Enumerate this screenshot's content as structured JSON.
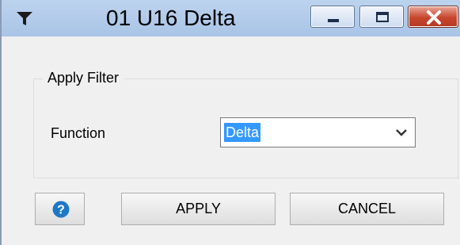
{
  "window": {
    "title": "01 U16 Delta",
    "icons": {
      "app": "filter-funnel-icon",
      "minimize": "minimize-icon",
      "maximize": "maximize-icon",
      "close": "close-icon"
    }
  },
  "group": {
    "legend": "Apply Filter",
    "function_label": "Function",
    "function_value": "Delta",
    "dropdown_icon": "chevron-down-icon"
  },
  "buttons": {
    "help_icon": "help-icon",
    "apply": "APPLY",
    "cancel": "CANCEL"
  },
  "colors": {
    "titlebar": "#bcd3ee",
    "selection": "#3399ff",
    "close": "#c7462c",
    "help": "#1e78c8"
  }
}
